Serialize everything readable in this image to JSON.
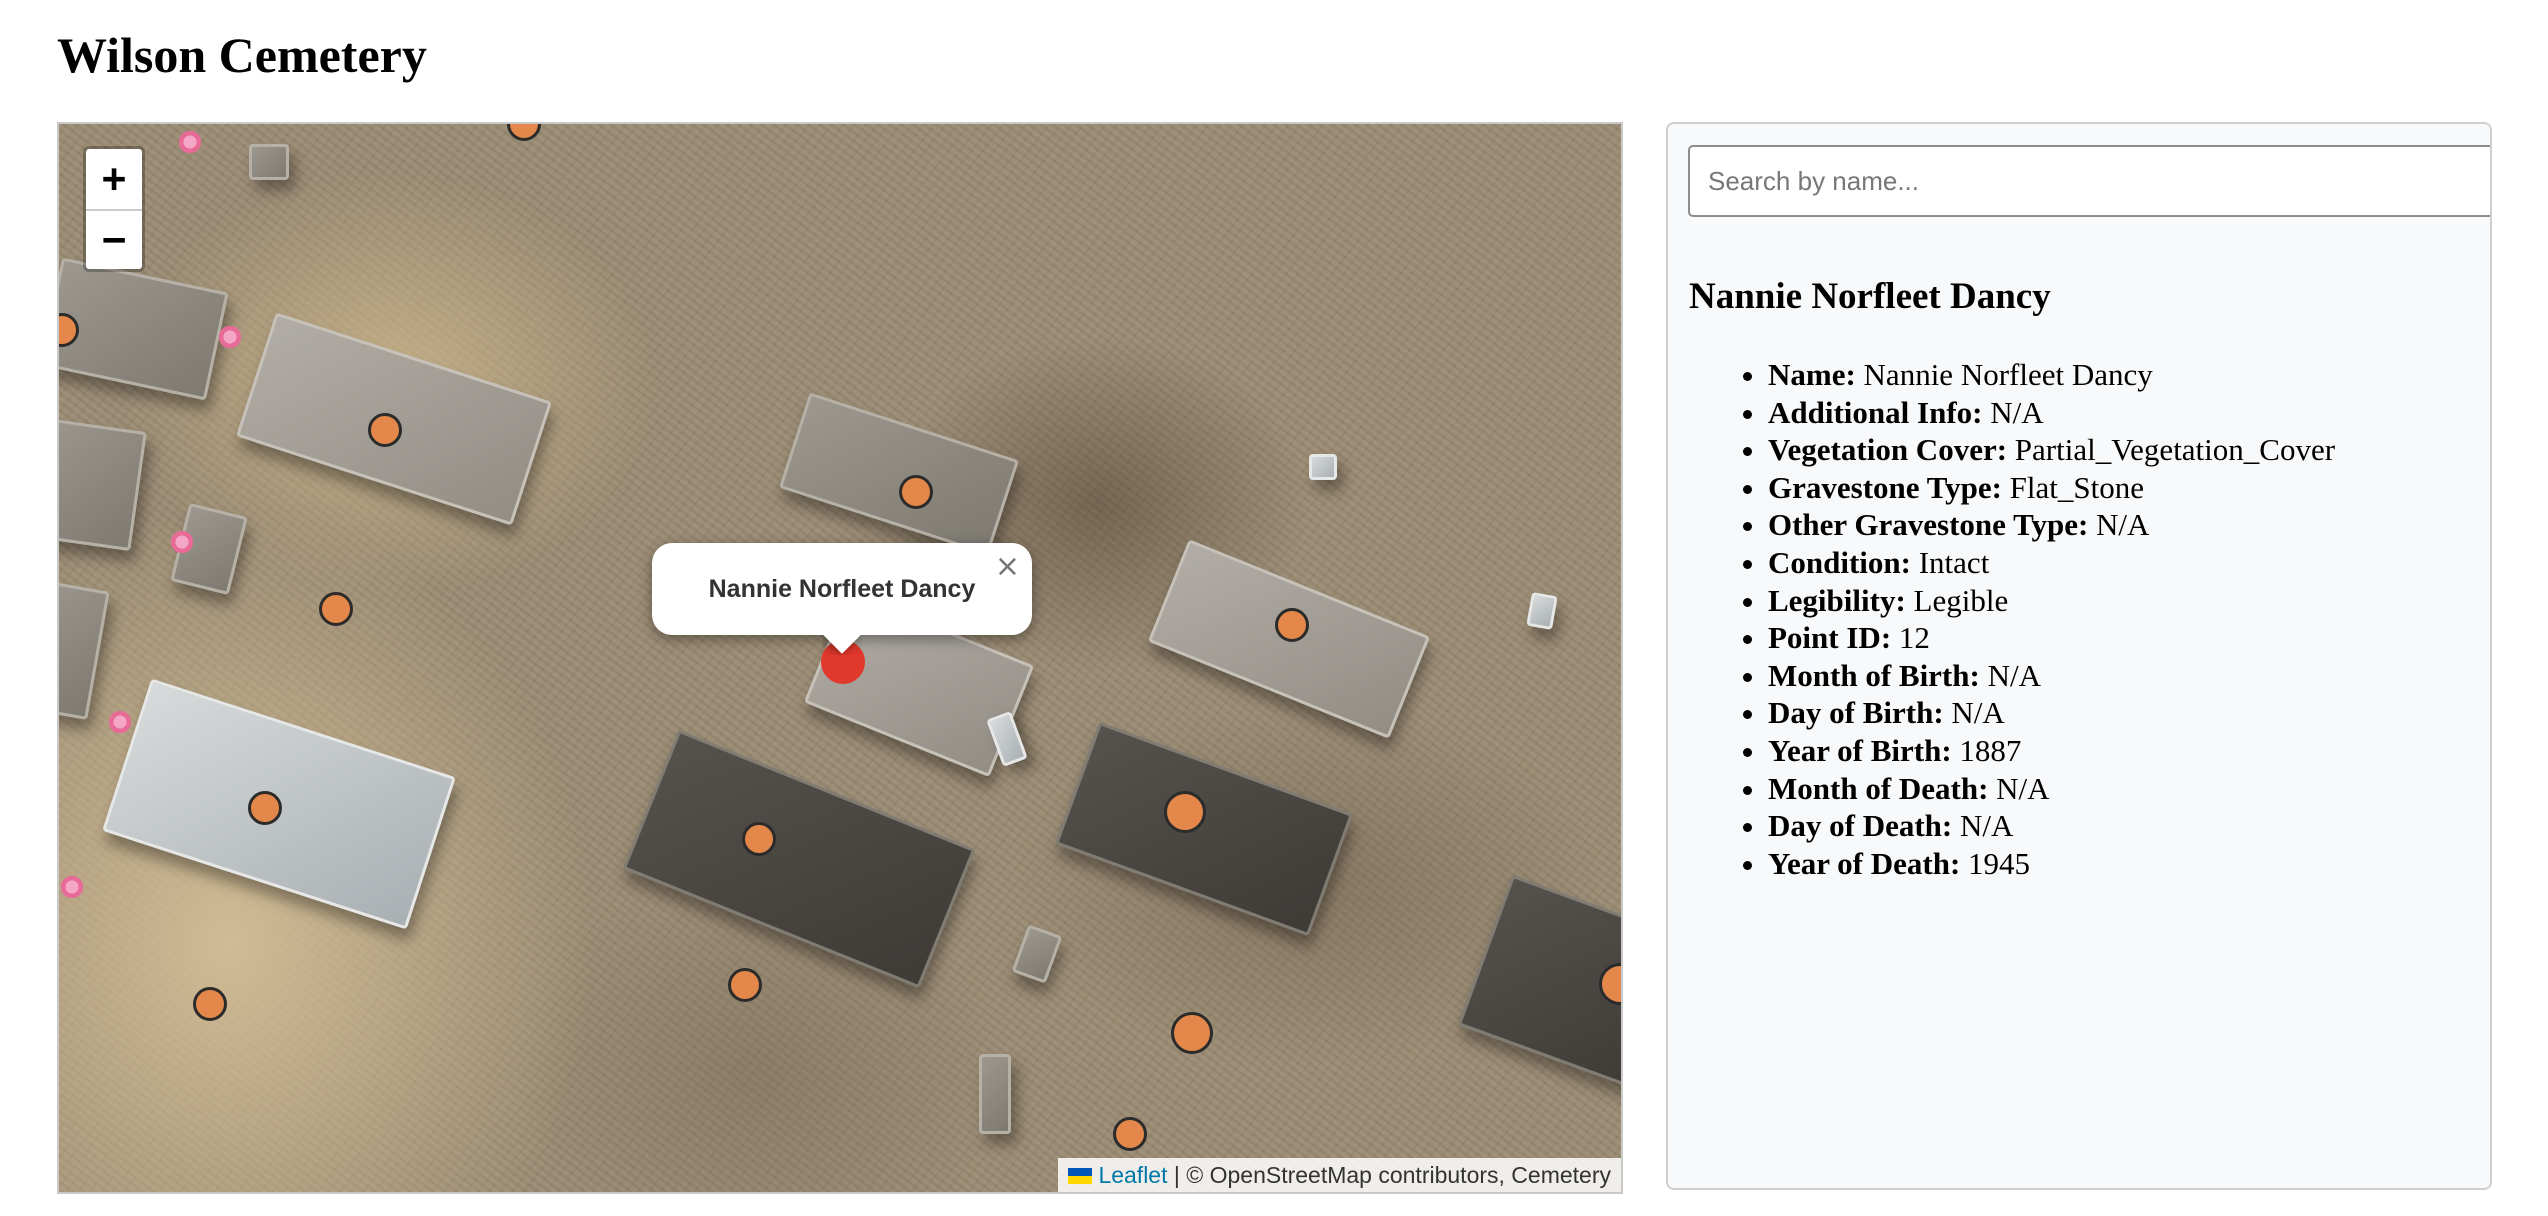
{
  "page": {
    "title": "Wilson Cemetery"
  },
  "map": {
    "zoom_in_label": "+",
    "zoom_out_label": "−",
    "popup": {
      "title": "Nannie Norfleet Dancy",
      "close_label": "×"
    },
    "attribution": {
      "leaflet_label": "Leaflet",
      "rest": "| © OpenStreetMap contributors, Cemetery"
    },
    "colors": {
      "marker": "#e3884a",
      "selected_marker": "#e0382d"
    }
  },
  "search": {
    "placeholder": "Search by name...",
    "value": ""
  },
  "record": {
    "heading": "Nannie Norfleet Dancy",
    "fields": [
      {
        "label": "Name:",
        "value": "Nannie Norfleet Dancy"
      },
      {
        "label": "Additional Info:",
        "value": "N/A"
      },
      {
        "label": "Vegetation Cover:",
        "value": "Partial_Vegetation_Cover"
      },
      {
        "label": "Gravestone Type:",
        "value": "Flat_Stone"
      },
      {
        "label": "Other Gravestone Type:",
        "value": "N/A"
      },
      {
        "label": "Condition:",
        "value": "Intact"
      },
      {
        "label": "Legibility:",
        "value": "Legible"
      },
      {
        "label": "Point ID:",
        "value": "12"
      },
      {
        "label": "Month of Birth:",
        "value": "N/A"
      },
      {
        "label": "Day of Birth:",
        "value": "N/A"
      },
      {
        "label": "Year of Birth:",
        "value": "1887"
      },
      {
        "label": "Month of Death:",
        "value": "N/A"
      },
      {
        "label": "Day of Death:",
        "value": "N/A"
      },
      {
        "label": "Year of Death:",
        "value": "1945"
      }
    ]
  }
}
